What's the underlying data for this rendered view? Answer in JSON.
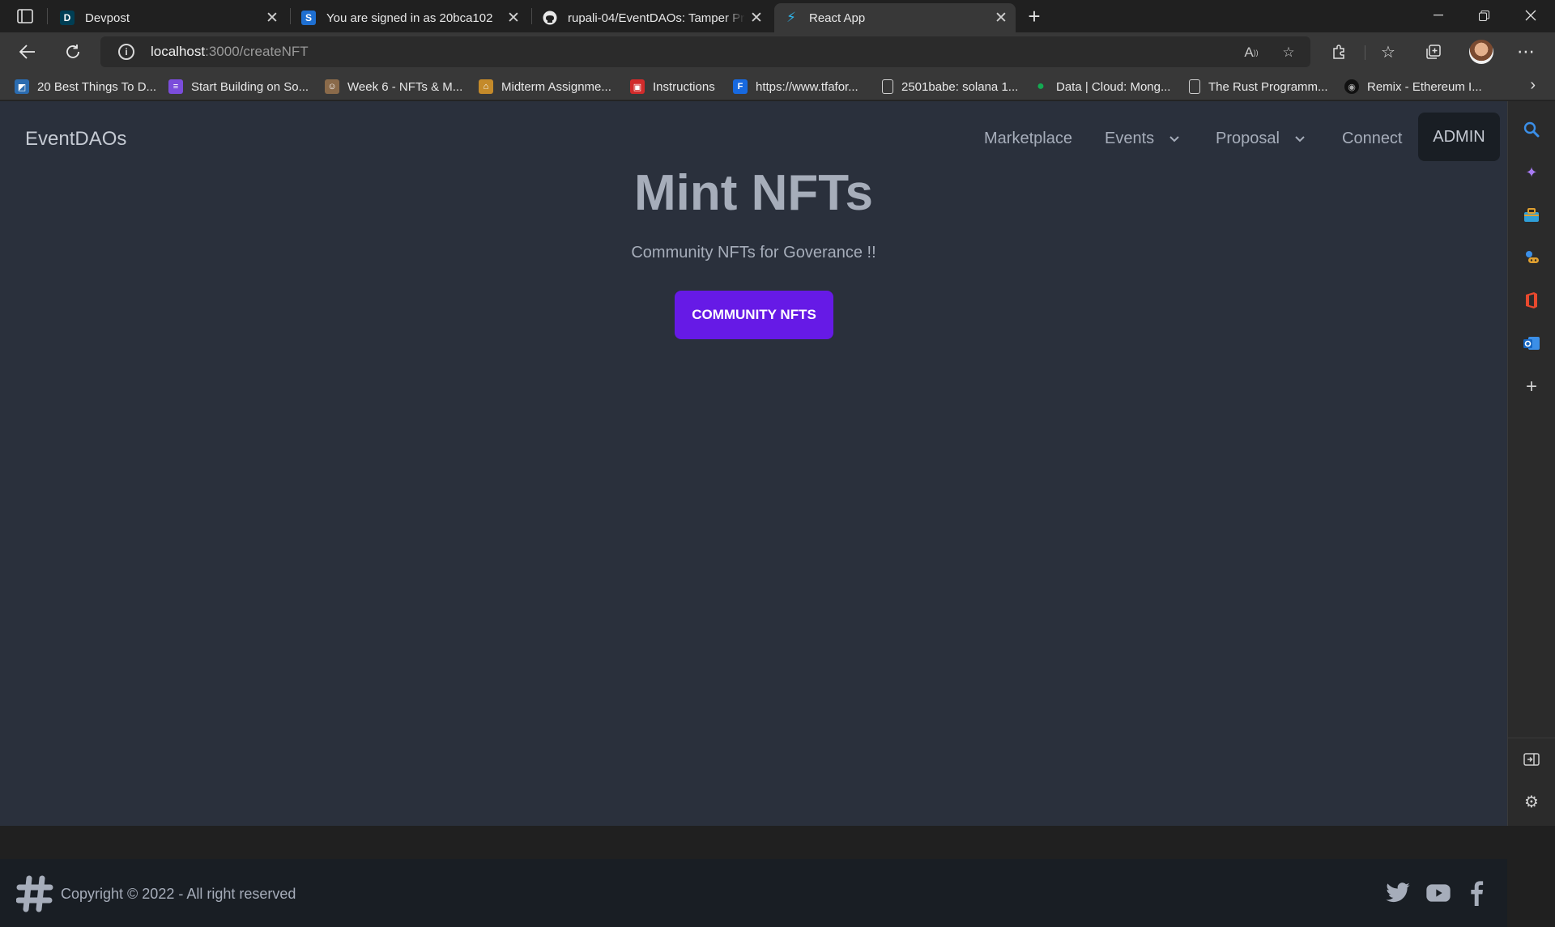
{
  "browser": {
    "tabs": [
      {
        "title": "Devpost",
        "favicon_letter": "D",
        "favicon_color": "#003e54"
      },
      {
        "title": "You are signed in as 20bca102",
        "favicon_letter": "S",
        "favicon_color": "#1e6fd1"
      },
      {
        "title": "rupali-04/EventDAOs: Tamper Pr",
        "favicon_letter": "",
        "favicon_color": "#202020"
      },
      {
        "title": "React App",
        "favicon_letter": "",
        "favicon_color": "#2e8ad8"
      }
    ],
    "address": {
      "host": "localhost",
      "path": ":3000/createNFT"
    },
    "bookmarks": [
      {
        "label": "20 Best Things To D...",
        "icon_color": "#2b6cb0"
      },
      {
        "label": "Start Building on So...",
        "icon_color": "#7b4ddb"
      },
      {
        "label": "Week 6 - NFTs & M...",
        "icon_color": "#8a6a4a"
      },
      {
        "label": "Midterm Assignme...",
        "icon_color": "#c48a2a"
      },
      {
        "label": "Instructions",
        "icon_color": "#d12b2b"
      },
      {
        "label": "https://www.tfafor...",
        "icon_color": "#1769e0"
      },
      {
        "label": "2501babe: solana 1...",
        "icon_color": "#5a5a5a"
      },
      {
        "label": "Data | Cloud: Mong...",
        "icon_color": "#13aa52"
      },
      {
        "label": "The Rust Programm...",
        "icon_color": "#5a5a5a"
      },
      {
        "label": "Remix - Ethereum I...",
        "icon_color": "#222222"
      }
    ]
  },
  "app": {
    "brand": "EventDAOs",
    "nav": {
      "marketplace": "Marketplace",
      "events": "Events",
      "proposal": "Proposal",
      "connect": "Connect",
      "admin": "ADMIN"
    },
    "hero": {
      "title": "Mint NFTs",
      "subtitle": "Community NFTs for Goverance !!",
      "button": "COMMUNITY NFTS"
    },
    "footer": {
      "copyright": "Copyright © 2022 - All right reserved"
    },
    "colors": {
      "background": "#2a303c",
      "primary": "#661ae6",
      "footer": "#191e24"
    }
  }
}
